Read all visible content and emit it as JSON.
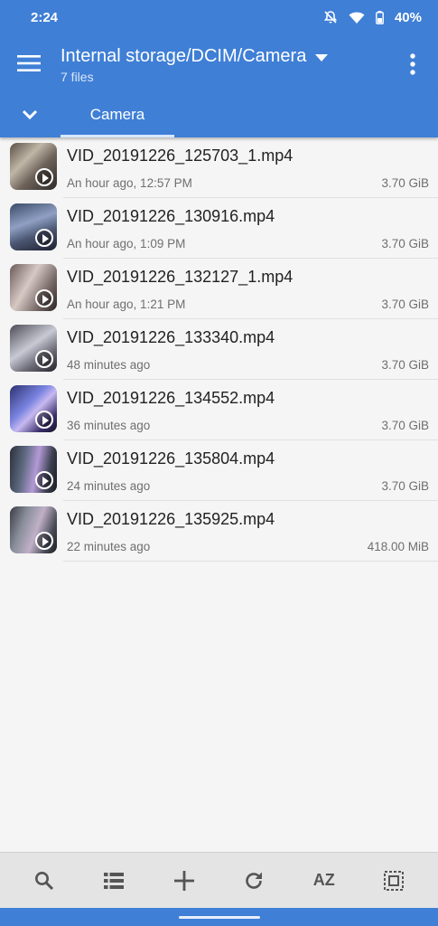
{
  "status_bar": {
    "time": "2:24",
    "battery": "40%"
  },
  "app_bar": {
    "title": "Internal storage/DCIM/Camera",
    "subtitle": "7 files"
  },
  "tabs": [
    {
      "label": "Camera"
    }
  ],
  "files": [
    {
      "name": "VID_20191226_125703_1.mp4",
      "date": "An hour ago, 12:57 PM",
      "size": "3.70 GiB"
    },
    {
      "name": "VID_20191226_130916.mp4",
      "date": "An hour ago, 1:09 PM",
      "size": "3.70 GiB"
    },
    {
      "name": "VID_20191226_132127_1.mp4",
      "date": "An hour ago, 1:21 PM",
      "size": "3.70 GiB"
    },
    {
      "name": "VID_20191226_133340.mp4",
      "date": "48 minutes ago",
      "size": "3.70 GiB"
    },
    {
      "name": "VID_20191226_134552.mp4",
      "date": "36 minutes ago",
      "size": "3.70 GiB"
    },
    {
      "name": "VID_20191226_135804.mp4",
      "date": "24 minutes ago",
      "size": "3.70 GiB"
    },
    {
      "name": "VID_20191226_135925.mp4",
      "date": "22 minutes ago",
      "size": "418.00 MiB"
    }
  ],
  "bottom_bar": {
    "search_icon": "search-icon",
    "view_icon": "list-view-icon",
    "add_icon": "add-icon",
    "refresh_icon": "refresh-icon",
    "sort_label": "AZ",
    "select_icon": "select-all-icon"
  },
  "colors": {
    "primary": "#3f7fd6",
    "background": "#f5f5f5",
    "bottom_bar": "#e4e4e4"
  }
}
